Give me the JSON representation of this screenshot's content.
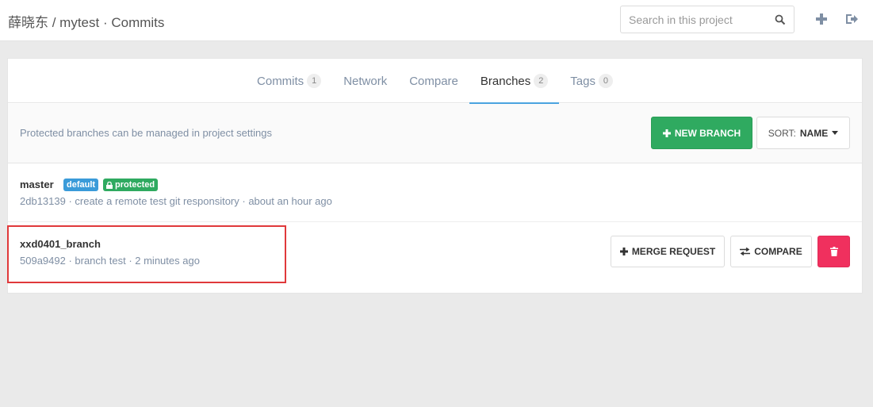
{
  "header": {
    "breadcrumb": "薛晓东 / mytest · Commits",
    "search_placeholder": "Search in this project",
    "icons": [
      "search-icon",
      "plus-icon",
      "sign-out-icon"
    ]
  },
  "tabs": [
    {
      "label": "Commits",
      "count": "1",
      "active": false
    },
    {
      "label": "Network",
      "count": null,
      "active": false
    },
    {
      "label": "Compare",
      "count": null,
      "active": false
    },
    {
      "label": "Branches",
      "count": "2",
      "active": true
    },
    {
      "label": "Tags",
      "count": "0",
      "active": false
    }
  ],
  "infobar": {
    "note": "Protected branches can be managed in project settings",
    "new_branch_label": "NEW BRANCH",
    "sort_label": "SORT:",
    "sort_value": "NAME"
  },
  "branches": [
    {
      "name": "master",
      "labels": [
        "default",
        "protected"
      ],
      "meta": "2db13139 · create a remote test git responsitory · about an hour ago"
    },
    {
      "name": "xxd0401_branch",
      "meta": "509a9492 · branch test · 2 minutes ago",
      "merge_request_label": "MERGE REQUEST",
      "compare_label": "COMPARE"
    }
  ],
  "colors": {
    "primary_green": "#2faa60",
    "danger_red": "#f0305e",
    "tab_underline": "#4aa3df",
    "highlight_box": "#e0393b"
  }
}
